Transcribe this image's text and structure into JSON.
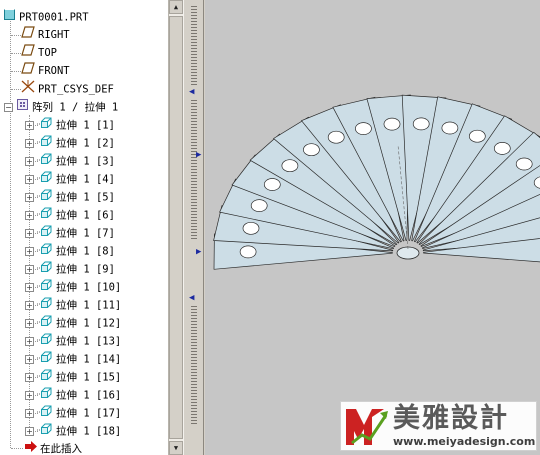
{
  "model_tree": {
    "root": {
      "label": "PRT0001.PRT",
      "icon": "part-icon"
    },
    "datums": [
      {
        "label": "RIGHT",
        "icon": "datum-plane-icon"
      },
      {
        "label": "TOP",
        "icon": "datum-plane-icon"
      },
      {
        "label": "FRONT",
        "icon": "datum-plane-icon"
      },
      {
        "label": "PRT_CSYS_DEF",
        "icon": "coordinate-system-icon"
      }
    ],
    "pattern": {
      "label": "阵列 1 / 拉伸 1",
      "icon": "pattern-icon",
      "expanded": true
    },
    "pattern_members": [
      {
        "label": "拉伸 1 [1]"
      },
      {
        "label": "拉伸 1 [2]"
      },
      {
        "label": "拉伸 1 [3]"
      },
      {
        "label": "拉伸 1 [4]"
      },
      {
        "label": "拉伸 1 [5]"
      },
      {
        "label": "拉伸 1 [6]"
      },
      {
        "label": "拉伸 1 [7]"
      },
      {
        "label": "拉伸 1 [8]"
      },
      {
        "label": "拉伸 1 [9]"
      },
      {
        "label": "拉伸 1 [10]"
      },
      {
        "label": "拉伸 1 [11]"
      },
      {
        "label": "拉伸 1 [12]"
      },
      {
        "label": "拉伸 1 [13]"
      },
      {
        "label": "拉伸 1 [14]"
      },
      {
        "label": "拉伸 1 [15]"
      },
      {
        "label": "拉伸 1 [16]"
      },
      {
        "label": "拉伸 1 [17]"
      },
      {
        "label": "拉伸 1 [18]"
      }
    ],
    "insert_here": {
      "label": "在此插入",
      "icon": "insert-arrow-icon"
    }
  },
  "viewport": {
    "background": "#c6c6c6",
    "model_fill": "#ccdde6",
    "model_edge": "#2a2a2a",
    "blade_count": 18
  },
  "watermark": {
    "logo_icon": "my-logo-icon",
    "name": "美雅設計",
    "url": "www.meiyadesign.com",
    "brand_red": "#cc2222",
    "brand_green": "#5aa020"
  },
  "colors": {
    "tree_bg": "#ffffff",
    "panel_bg": "#d4d0c8",
    "splitter_arrow": "#1c2aa0",
    "icon_cyan": "#1a9fb0",
    "insert_red": "#cc1010"
  }
}
